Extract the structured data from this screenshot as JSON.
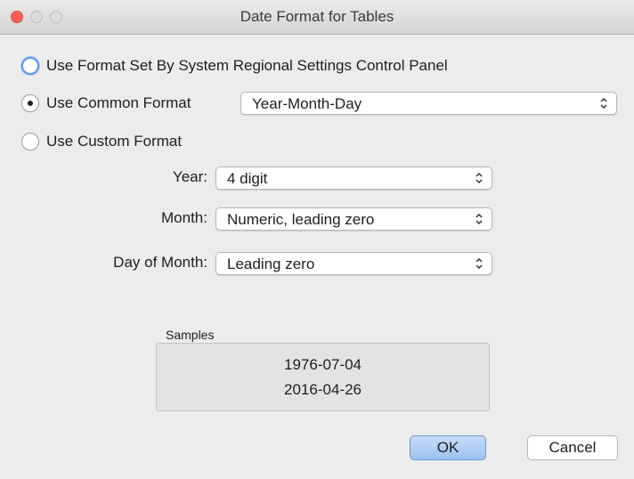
{
  "window": {
    "title": "Date Format for Tables"
  },
  "options": {
    "system": {
      "label": "Use Format Set By System Regional Settings Control Panel",
      "selected": false
    },
    "common": {
      "label": "Use Common Format",
      "selected": true,
      "value": "Year-Month-Day"
    },
    "custom": {
      "label": "Use Custom Format",
      "selected": false
    }
  },
  "custom_fields": {
    "year": {
      "label": "Year:",
      "value": "4 digit"
    },
    "month": {
      "label": "Month:",
      "value": "Numeric, leading zero"
    },
    "day": {
      "label": "Day of Month:",
      "value": "Leading zero"
    }
  },
  "samples": {
    "label": "Samples",
    "items": [
      "1976-07-04",
      "2016-04-26"
    ]
  },
  "buttons": {
    "ok": "OK",
    "cancel": "Cancel"
  },
  "colors": {
    "close": "#fc605c",
    "focus_ring": "#5a9bf1",
    "default_button": "#9dc2f0"
  },
  "icons": {
    "popup": "updown-chevron-icon"
  }
}
